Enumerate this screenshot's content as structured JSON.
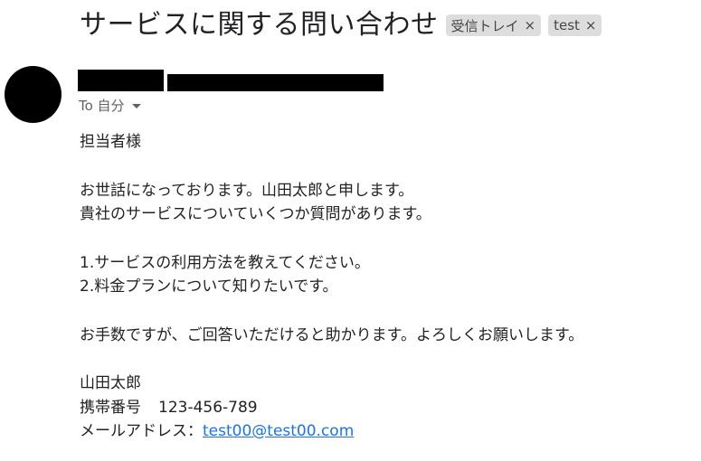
{
  "subject": "サービスに関する問い合わせ",
  "labels": [
    {
      "label": "受信トレイ",
      "close": "×"
    },
    {
      "label": "test",
      "close": "×"
    }
  ],
  "recipient": {
    "text": "To 自分"
  },
  "body": {
    "greeting": "担当者様",
    "para1": [
      "お世話になっております。山田太郎と申します。",
      "貴社のサービスについていくつか質問があります。"
    ],
    "para2": [
      "1.サービスの利用方法を教えてください。",
      "2.料金プランについて知りたいです。"
    ],
    "closing": "お手数ですが、ご回答いただけると助かります。よろしくお願いします。",
    "signature": {
      "name": "山田太郎",
      "phone_label": "携帯番号",
      "phone": "123-456-789",
      "email_label": "メールアドレス：",
      "email": "test00@test00.com"
    }
  },
  "colors": {
    "link": "#1a73e8",
    "chip_bg": "#dddddd",
    "redaction": "#000000"
  }
}
